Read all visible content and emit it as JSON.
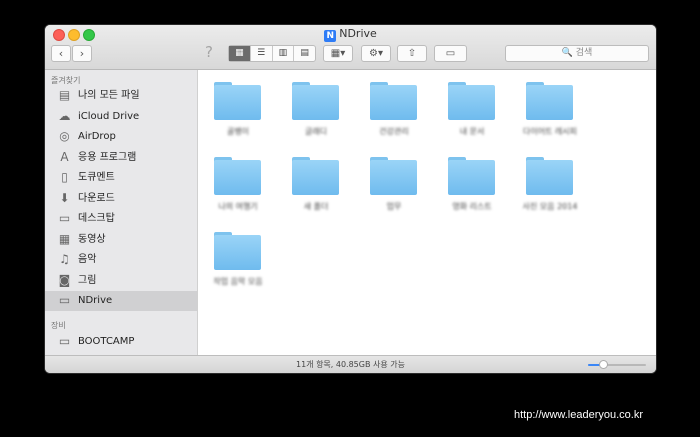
{
  "window": {
    "title": "NDrive",
    "app_icon_letter": "N"
  },
  "toolbar": {
    "back_glyph": "‹",
    "forward_glyph": "›",
    "help_glyph": "?",
    "view_modes": [
      {
        "name": "icon-view",
        "glyph": "▦",
        "selected": true
      },
      {
        "name": "list-view",
        "glyph": "☰",
        "selected": false
      },
      {
        "name": "column-view",
        "glyph": "▥",
        "selected": false
      },
      {
        "name": "coverflow-view",
        "glyph": "▤",
        "selected": false
      }
    ],
    "arrange_glyph": "▦▾",
    "action_glyph": "⚙▾",
    "share_glyph": "⇧",
    "tag_glyph": "▭",
    "search_placeholder": "🔍 검색"
  },
  "sidebar": {
    "favorites_header": "즐겨찾기",
    "favorites": [
      {
        "label": "나의 모든 파일",
        "icon": "all-files-icon",
        "glyph": "▤",
        "selected": false
      },
      {
        "label": "iCloud Drive",
        "icon": "cloud-icon",
        "glyph": "☁",
        "selected": false
      },
      {
        "label": "AirDrop",
        "icon": "airdrop-icon",
        "glyph": "◎",
        "selected": false
      },
      {
        "label": "응용 프로그램",
        "icon": "applications-icon",
        "glyph": "A",
        "selected": false
      },
      {
        "label": "도큐멘트",
        "icon": "documents-icon",
        "glyph": "▯",
        "selected": false
      },
      {
        "label": "다운로드",
        "icon": "downloads-icon",
        "glyph": "⬇",
        "selected": false
      },
      {
        "label": "데스크탑",
        "icon": "desktop-icon",
        "glyph": "▭",
        "selected": false
      },
      {
        "label": "동영상",
        "icon": "movies-icon",
        "glyph": "▦",
        "selected": false
      },
      {
        "label": "음악",
        "icon": "music-icon",
        "glyph": "♫",
        "selected": false
      },
      {
        "label": "그림",
        "icon": "pictures-icon",
        "glyph": "◙",
        "selected": false
      },
      {
        "label": "NDrive",
        "icon": "folder-icon",
        "glyph": "▭",
        "selected": true
      }
    ],
    "devices_header": "장비",
    "devices": [
      {
        "label": "BOOTCAMP",
        "icon": "disk-icon",
        "glyph": "▭"
      }
    ]
  },
  "folders": [
    {
      "label": "골뱅이"
    },
    {
      "label": "글래디"
    },
    {
      "label": "건강관리"
    },
    {
      "label": "내 문서"
    },
    {
      "label": "다이어트 레시피"
    },
    {
      "label": "나의 여행기"
    },
    {
      "label": "새 폴더"
    },
    {
      "label": "업무"
    },
    {
      "label": "영화 리스트"
    },
    {
      "label": "사진 모음 2014"
    },
    {
      "label": "작업 음악 모음"
    }
  ],
  "statusbar": {
    "text": "11개 항목, 40.85GB 사용 가능",
    "zoom_fraction": 0.25
  },
  "watermark": "http://www.leaderyou.co.kr"
}
